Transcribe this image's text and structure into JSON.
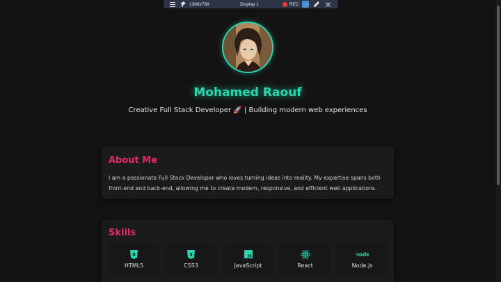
{
  "recorder": {
    "resolution": "1366x768",
    "display": "Display 1",
    "rec_label": "REC"
  },
  "profile": {
    "name": "Mohamed Raouf",
    "tagline": "Creative Full Stack Developer 🚀 | Building modern web experiences"
  },
  "about": {
    "heading": "About Me",
    "text": "I am a passionate Full Stack Developer who loves turning ideas into reality. My expertise spans both front-end and back-end, allowing me to create modern, responsive, and efficient web applications."
  },
  "skills": {
    "heading": "Skills",
    "items": [
      {
        "label": "HTML5",
        "icon": "html5-icon"
      },
      {
        "label": "CSS3",
        "icon": "css3-icon"
      },
      {
        "label": "JavaScript",
        "icon": "javascript-icon"
      },
      {
        "label": "React",
        "icon": "react-icon"
      },
      {
        "label": "Node.js",
        "icon": "nodejs-icon"
      }
    ]
  },
  "colors": {
    "accent_teal": "#2bd5b0",
    "accent_pink": "#e8286b",
    "background": "#131313",
    "card": "#1b1b1b"
  }
}
